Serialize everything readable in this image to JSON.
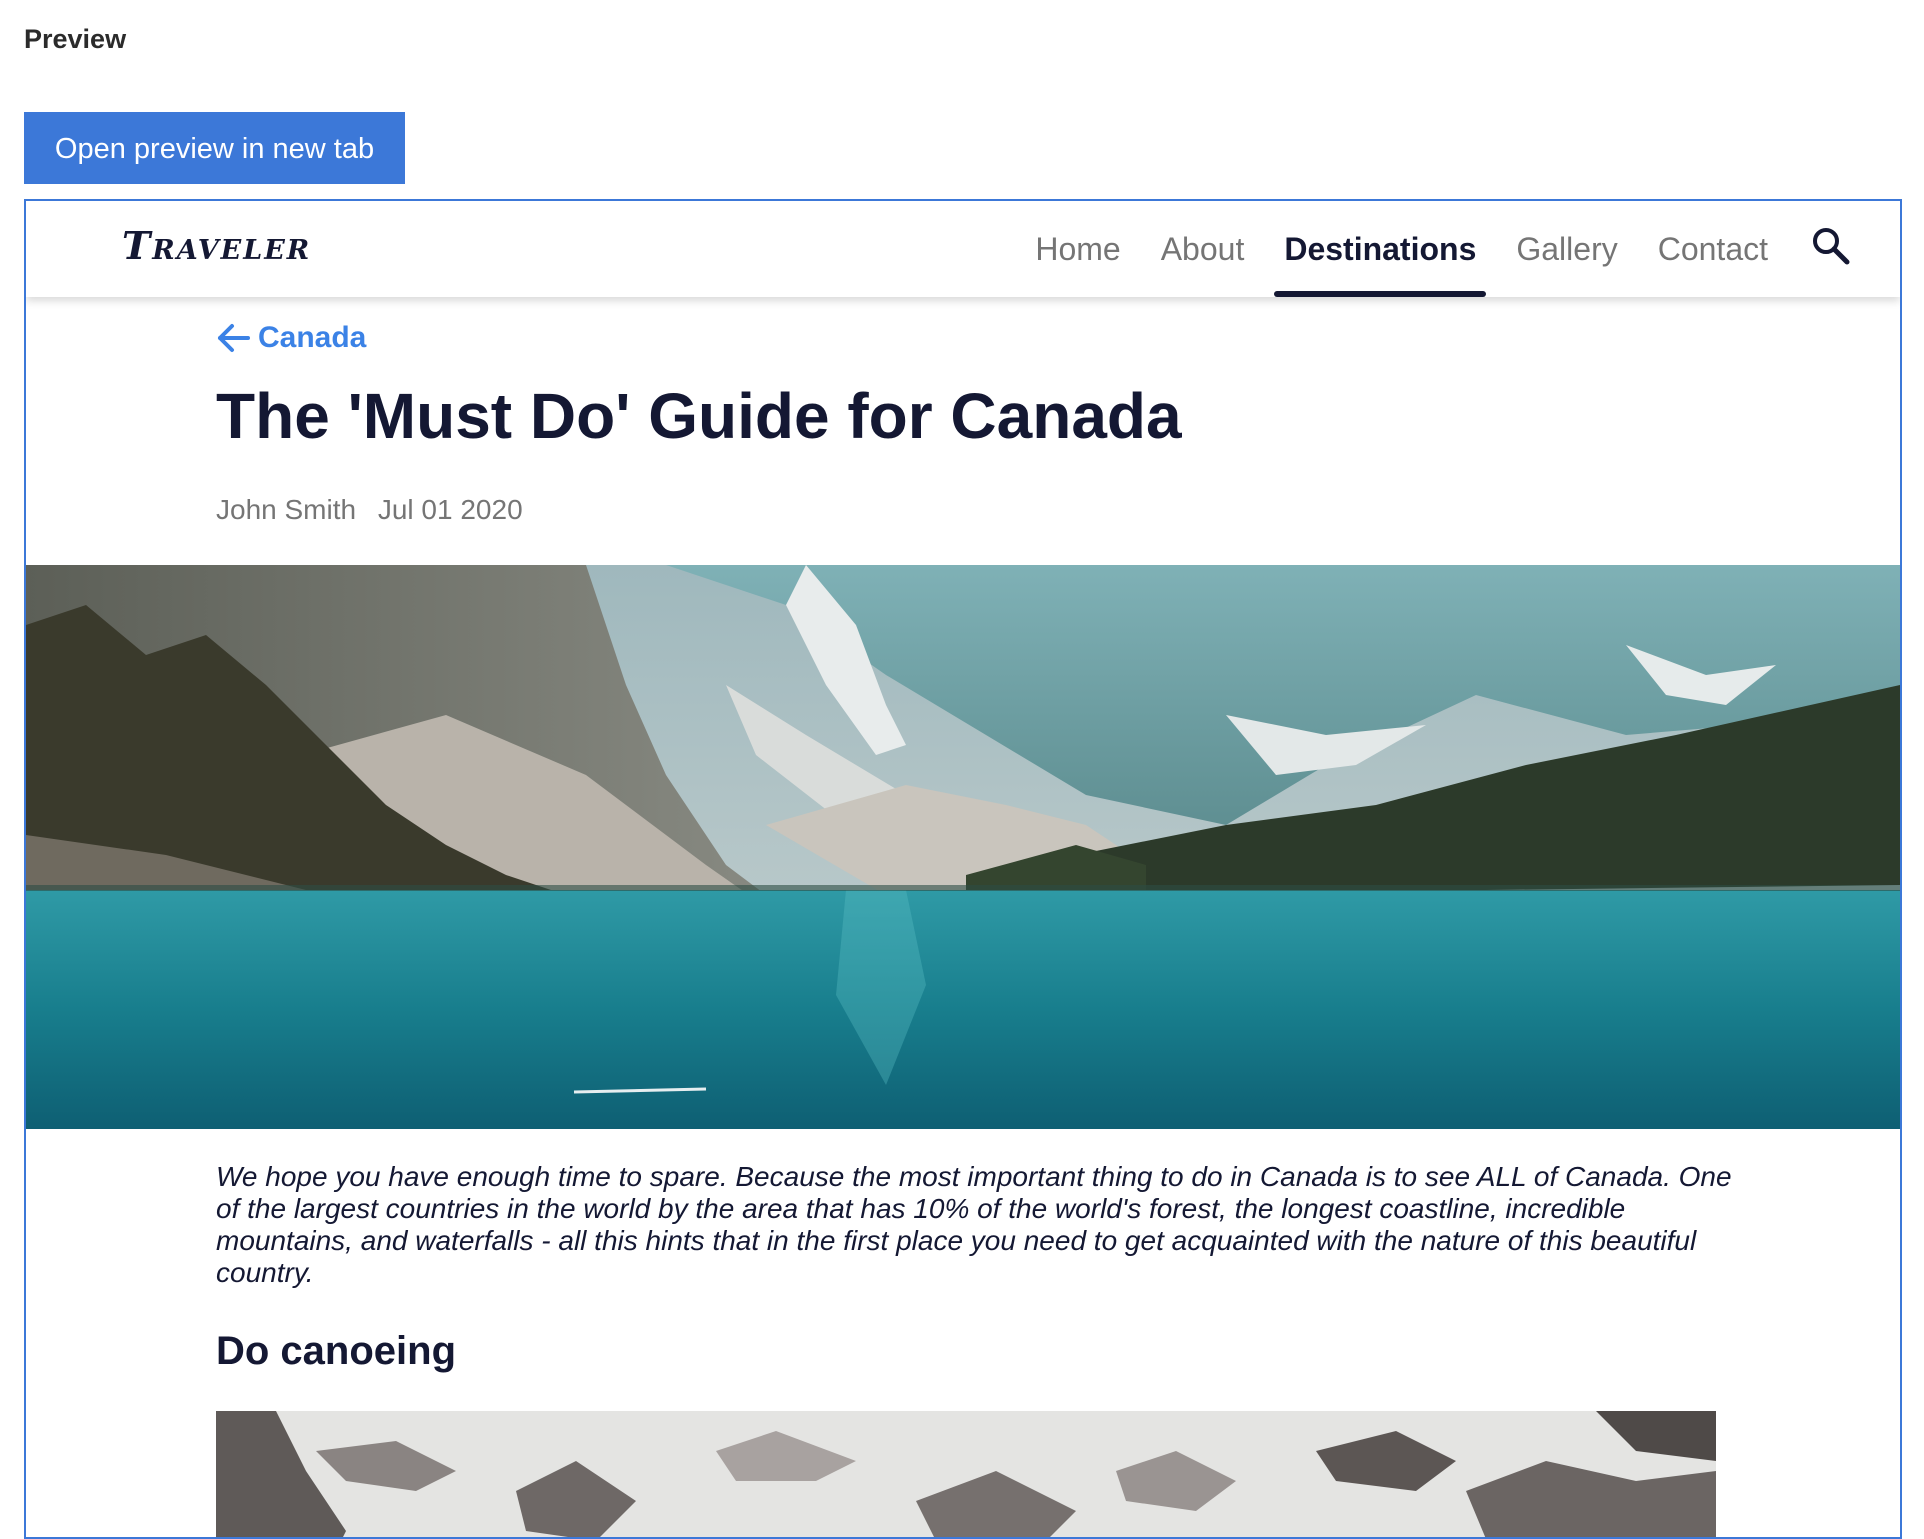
{
  "preview": {
    "label": "Preview",
    "open_button": "Open preview in new tab"
  },
  "site": {
    "logo": "Traveler",
    "nav": [
      {
        "label": "Home",
        "active": false
      },
      {
        "label": "About",
        "active": false
      },
      {
        "label": "Destinations",
        "active": true
      },
      {
        "label": "Gallery",
        "active": false
      },
      {
        "label": "Contact",
        "active": false
      }
    ],
    "search_icon": "search-icon",
    "accent_color": "#3b82e6",
    "text_color": "#141833"
  },
  "article": {
    "back_label": "Canada",
    "title": "The 'Must Do' Guide for Canada",
    "author": "John Smith",
    "date": "Jul 01 2020",
    "intro": "We hope you have enough time to spare. Because the most important thing to do in Canada is to see ALL of Canada. One of the largest countries in the world by the area that has 10% of the world's forest, the longest coastline, incredible mountains, and waterfalls - all this hints that in the first place you need to get acquainted with the nature of this beautiful country.",
    "section_heading": "Do canoeing"
  }
}
